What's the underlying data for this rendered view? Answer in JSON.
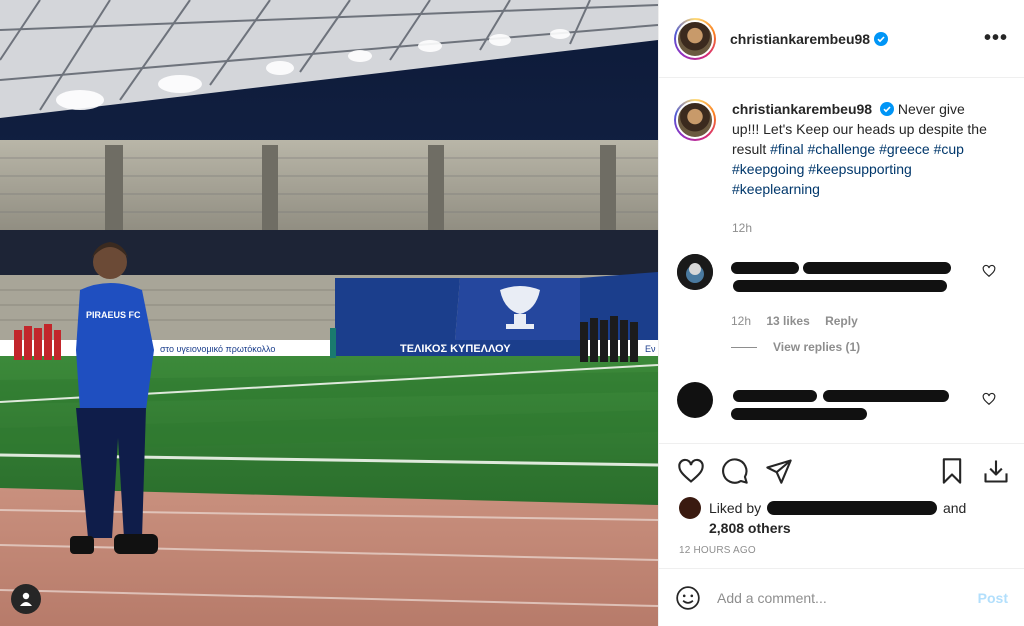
{
  "post": {
    "username": "christiankarembeu98",
    "caption_text": "Never give up!!! Let's Keep our heads up despite the result",
    "hashtags": [
      "#final",
      "#challenge",
      "#greece",
      "#cup",
      "#keepgoing",
      "#keepsupporting",
      "#keeplearning"
    ],
    "caption_time": "12h",
    "timestamp": "12 HOURS AGO"
  },
  "photo": {
    "shirt_text": "PIRAEUS FC",
    "banner_cup": "ΤΕΛΙΚΟΣ ΚΥΠΕΛΛΟΥ",
    "board_text": "στο υγειονομικό πρωτόκολλο",
    "side_text": "Εν"
  },
  "comments": [
    {
      "time": "12h",
      "likes": "13 likes",
      "reply": "Reply",
      "view_replies": "View replies (1)"
    },
    {}
  ],
  "likes": {
    "prefix": "Liked by",
    "and": "and",
    "others": "2,808 others"
  },
  "add_comment": {
    "placeholder": "Add a comment...",
    "post_label": "Post"
  },
  "icons": {
    "more": "more-options-icon",
    "verified": "verified-badge-icon",
    "like": "heart-icon",
    "comment": "comment-icon",
    "share": "paper-plane-icon",
    "save": "bookmark-icon",
    "download": "download-icon",
    "emoji": "smiley-icon",
    "user": "user-tag-icon"
  },
  "colors": {
    "link": "#00376b",
    "verified": "#0095f6",
    "muted": "#8e8e8e",
    "post_disabled": "#b2dffc"
  }
}
